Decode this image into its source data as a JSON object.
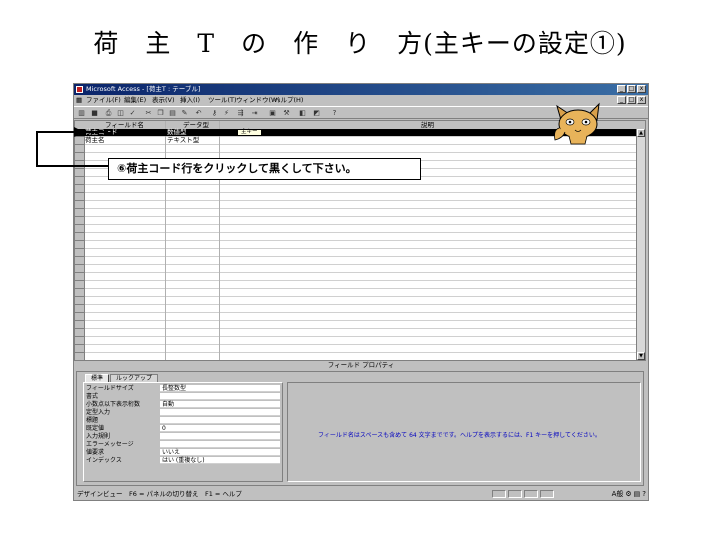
{
  "slide": {
    "title": "荷　主　T　の　作　り　方(主キーの設定①)"
  },
  "window": {
    "title": "Microsoft Access - [荷主T : テーブル]",
    "min": "_",
    "max": "□",
    "close": "x"
  },
  "menu": [
    "ファイル(F)",
    "編集(E)",
    "表示(V)",
    "挿入(I)",
    "ツール(T)",
    "ウィンドウ(W)",
    "ヘルプ(H)"
  ],
  "grid": {
    "headers": {
      "field": "フィールド名",
      "type": "データ型",
      "desc": "説明"
    },
    "rows": [
      {
        "field": "荷主コード",
        "type": "数値型",
        "selected": true
      },
      {
        "field": "荷主名",
        "type": "テキスト型",
        "selected": false
      }
    ],
    "tooltip": "主キー"
  },
  "properties": {
    "section_title": "フィールド プロパティ",
    "tabs": [
      "標準",
      "ルックアップ"
    ],
    "rows": [
      {
        "name": "フィールドサイズ",
        "value": "長整数型"
      },
      {
        "name": "書式",
        "value": ""
      },
      {
        "name": "小数点以下表示桁数",
        "value": "自動"
      },
      {
        "name": "定型入力",
        "value": ""
      },
      {
        "name": "標題",
        "value": ""
      },
      {
        "name": "既定値",
        "value": "0"
      },
      {
        "name": "入力規則",
        "value": ""
      },
      {
        "name": "エラーメッセージ",
        "value": ""
      },
      {
        "name": "値要求",
        "value": "いいえ"
      },
      {
        "name": "インデックス",
        "value": "はい (重複なし)"
      }
    ],
    "help_text": "フィールド名はスペースも含めて 64 文字までです。ヘルプを表示するには、F1 キーを押してください。"
  },
  "status": {
    "text": "デザインビュー　F6 = パネルの切り替え　F1 = ヘルプ",
    "tray": "A般"
  },
  "callout": {
    "text": "⑥荷主コード行をクリックして黒くして下さい。"
  }
}
